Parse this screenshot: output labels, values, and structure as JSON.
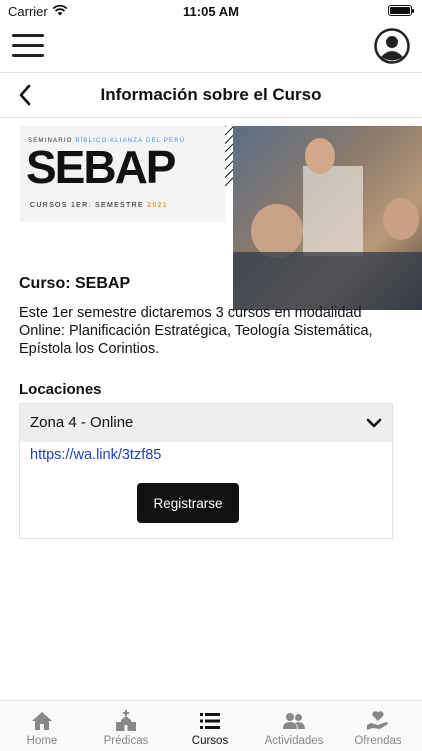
{
  "status_bar": {
    "carrier": "Carrier",
    "time": "11:05 AM"
  },
  "page": {
    "title": "Información sobre el Curso"
  },
  "banner": {
    "seminar_text_1": "SEMINARIO",
    "seminar_text_2": "BÍBLICO ALIANZA DEL PERÚ",
    "logo": "SEBAP",
    "cursos_text": "CURSOS 1ER. SEMESTRE",
    "year": "2021"
  },
  "course": {
    "title": "Curso: SEBAP",
    "description": "Este 1er semestre dictaremos 3 cursos en modalidad Online: Planificación Estratégica, Teología Sistemática, Epístola los Corintios."
  },
  "locations": {
    "label": "Locaciones",
    "selected": "Zona 4 - Online",
    "link": "https://wa.link/3tzf85",
    "register_label": "Registrarse"
  },
  "tabs": [
    {
      "label": "Home",
      "icon": "home-icon"
    },
    {
      "label": "Prédicas",
      "icon": "church-icon"
    },
    {
      "label": "Cursos",
      "icon": "list-icon",
      "active": true
    },
    {
      "label": "Actividades",
      "icon": "people-icon"
    },
    {
      "label": "Ofrendas",
      "icon": "hand-heart-icon"
    }
  ],
  "colors": {
    "accent": "#111111",
    "link": "#1e3fbf",
    "inactive_tab": "#888888",
    "year": "#e9a23b"
  }
}
